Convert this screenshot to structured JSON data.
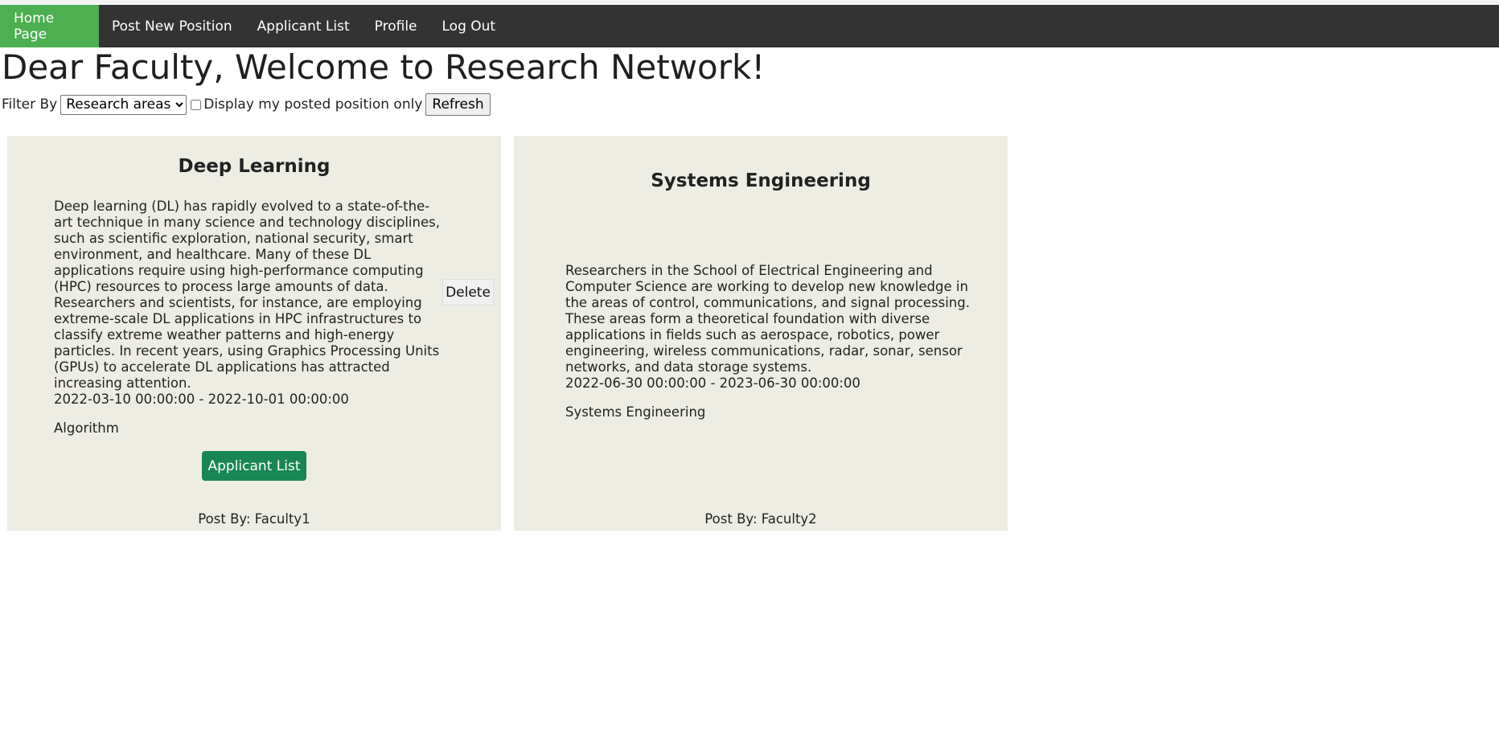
{
  "nav": {
    "items": [
      {
        "label": "Home Page",
        "active": true
      },
      {
        "label": "Post New Position",
        "active": false
      },
      {
        "label": "Applicant List",
        "active": false
      },
      {
        "label": "Profile",
        "active": false
      },
      {
        "label": "Log Out",
        "active": false
      }
    ]
  },
  "page": {
    "title": "Dear Faculty, Welcome to Research Network!"
  },
  "filter": {
    "label": "Filter By",
    "select_value": "Research areas",
    "checkbox_label": "Display my posted position only",
    "checkbox_checked": false,
    "refresh_label": "Refresh"
  },
  "positions": [
    {
      "title": "Deep Learning",
      "description": "Deep learning (DL) has rapidly evolved to a state-of-the-art technique in many science and technology disciplines, such as scientific exploration, national security, smart environment, and healthcare. Many of these DL applications require using high-performance computing (HPC) resources to process large amounts of data. Researchers and scientists, for instance, are employing extreme-scale DL applications in HPC infrastructures to classify extreme weather patterns and high-energy particles. In recent years, using Graphics Processing Units (GPUs) to accelerate DL applications has attracted increasing attention.",
      "dates": "2022-03-10 00:00:00 - 2022-10-01 00:00:00",
      "area": "Algorithm",
      "delete_label": "Delete",
      "applicant_button_label": "Applicant List",
      "posted_by": "Post By: Faculty1"
    },
    {
      "title": "Systems Engineering",
      "description": "Researchers in the School of Electrical Engineering and Computer Science are working to develop new knowledge in the areas of control, communications, and signal processing. These areas form a theoretical foundation with diverse applications in fields such as aerospace, robotics, power engineering, wireless communications, radar, sonar, sensor networks, and data storage systems.",
      "dates": "2022-06-30 00:00:00 - 2023-06-30 00:00:00",
      "area": "Systems Engineering",
      "posted_by": "Post By: Faculty2"
    }
  ],
  "colors": {
    "nav_bg": "#333333",
    "nav_active": "#4caf50",
    "card_bg": "#eeede4",
    "primary_button": "#198754"
  }
}
